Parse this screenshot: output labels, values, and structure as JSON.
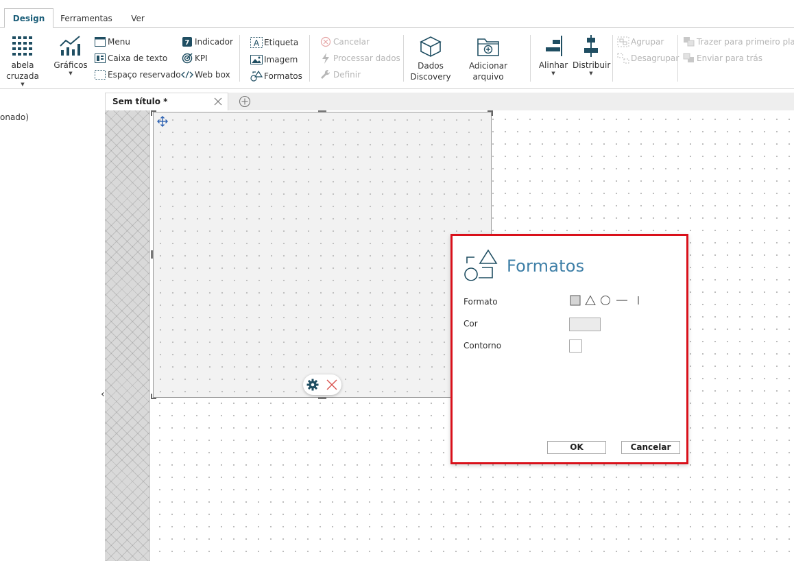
{
  "ribbon_tabs": [
    {
      "label": "Design",
      "active": true
    },
    {
      "label": "Ferramentas",
      "active": false
    },
    {
      "label": "Ver",
      "active": false
    }
  ],
  "ribbon": {
    "tabela_cruzada": "abela cruzada",
    "graficos": "Gráficos",
    "menu": "Menu",
    "caixa_texto": "Caixa de texto",
    "espaco_reservado": "Espaço reservado",
    "indicador": "Indicador",
    "kpi": "KPI",
    "web_box": "Web box",
    "etiqueta": "Etiqueta",
    "imagem": "Imagem",
    "formatos": "Formatos",
    "cancelar": "Cancelar",
    "processar_dados": "Processar dados",
    "definir": "Definir",
    "dados_discovery_line1": "Dados",
    "dados_discovery_line2": "Discovery",
    "adicionar_arquivo": "Adicionar arquivo",
    "alinhar": "Alinhar",
    "distribuir": "Distribuir",
    "agrupar": "Agrupar",
    "desagrupar": "Desagrupar",
    "trazer": "Trazer para primeiro plano",
    "enviar": "Enviar para trás"
  },
  "left_panel": {
    "text": "onado)"
  },
  "document_tab": {
    "title": "Sem título *"
  },
  "dialog": {
    "title": "Formatos",
    "labels": {
      "formato": "Formato",
      "cor": "Cor",
      "contorno": "Contorno"
    },
    "shape_options": [
      "rectangle-icon",
      "triangle-icon",
      "circle-icon",
      "horizontal-line-icon",
      "vertical-line-icon"
    ],
    "selected_shape": "rectangle-icon",
    "color_value": "#ebebeb",
    "ok_label": "OK",
    "cancel_label": "Cancelar"
  },
  "colors": {
    "accent": "#1d5f7a",
    "dialog_title": "#3e7fa7",
    "dialog_border": "#d9101a",
    "icon_dark": "#1f4e62",
    "close_red": "#d9534f"
  }
}
